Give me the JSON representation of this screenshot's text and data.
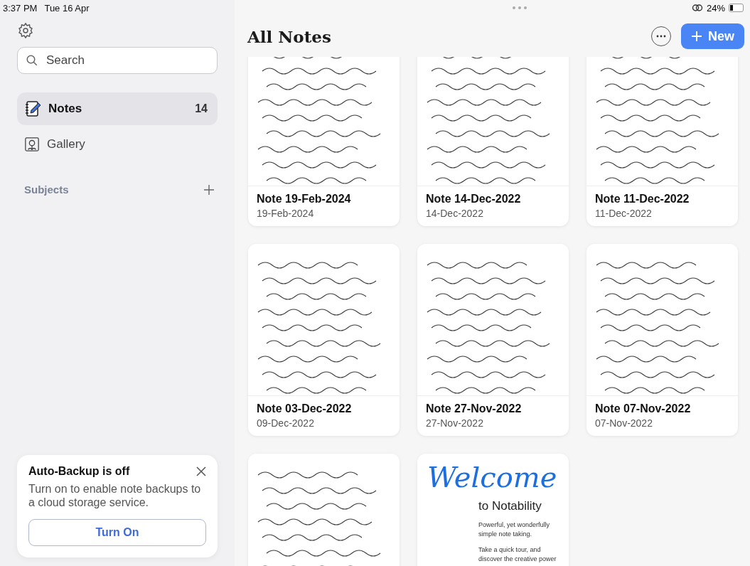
{
  "status_bar": {
    "time": "3:37 PM",
    "date": "Tue 16 Apr",
    "battery": "24%"
  },
  "sidebar": {
    "search": {
      "placeholder": "Search"
    },
    "items": [
      {
        "label": "Notes",
        "count": "14",
        "selected": true,
        "kind": "notes"
      },
      {
        "label": "Gallery",
        "selected": false,
        "kind": "gallery"
      }
    ],
    "subjects_heading": "Subjects",
    "backup_card": {
      "title": "Auto-Backup is off",
      "text": "Turn on to enable note backups to a cloud storage service.",
      "button": "Turn On"
    }
  },
  "header": {
    "title": "All Notes",
    "new_button": "New"
  },
  "notes": [
    {
      "kind": "handwritten",
      "title": "Note 19-Feb-2024",
      "date": "19-Feb-2024"
    },
    {
      "kind": "handwritten",
      "title": "Note 14-Dec-2022",
      "date": "14-Dec-2022"
    },
    {
      "kind": "handwritten",
      "title": "Note 11-Dec-2022",
      "date": "11-Dec-2022"
    },
    {
      "kind": "handwritten",
      "title": "Note 03-Dec-2022",
      "date": "09-Dec-2022"
    },
    {
      "kind": "handwritten",
      "title": "Note 27-Nov-2022",
      "date": "27-Nov-2022"
    },
    {
      "kind": "handwritten",
      "title": "Note 07-Nov-2022",
      "date": "07-Nov-2022"
    },
    {
      "kind": "handwritten"
    },
    {
      "kind": "welcome",
      "welcome": {
        "script": "Welcome",
        "subtitle": "to Notability",
        "lines": [
          "Powerful, yet wonderfully simple note taking.",
          "Take a quick tour, and discover the creative power"
        ]
      }
    }
  ]
}
